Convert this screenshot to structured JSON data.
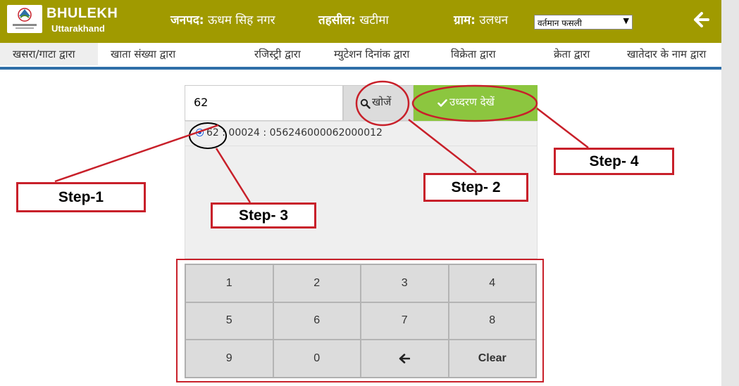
{
  "header": {
    "brand_title": "BHULEKH",
    "brand_subtitle": "Uttarakhand",
    "district_label": "जनपद:",
    "district_value": "ऊधम सिह नगर",
    "tehsil_label": "तहसील:",
    "tehsil_value": "खटीमा",
    "village_label": "ग्राम:",
    "village_value": "उलधन",
    "season_select_value": "वर्तमान फसली",
    "back_icon": "arrow-left-icon"
  },
  "tabs": [
    {
      "label": "खसरा/गाटा द्वारा"
    },
    {
      "label": "खाता संख्या द्वारा"
    },
    {
      "label": "रजिस्ट्री द्वारा"
    },
    {
      "label": "म्युटेशन दिनांक द्वारा"
    },
    {
      "label": "विक्रेता द्वारा"
    },
    {
      "label": "क्रेता द्वारा"
    },
    {
      "label": "खातेदार के नाम द्वारा"
    }
  ],
  "search": {
    "input_value": "62",
    "search_button_label": "खोजें",
    "view_button_label": "उध्दरण देखें"
  },
  "results": [
    {
      "text": "62 : 00024 : 056246000062000012",
      "selected": true
    }
  ],
  "keypad": [
    "1",
    "2",
    "3",
    "4",
    "5",
    "6",
    "7",
    "8",
    "9",
    "0",
    "←",
    "Clear"
  ],
  "annotations": {
    "step1": "Step-1",
    "step2": "Step- 2",
    "step3": "Step- 3",
    "step4": "Step- 4"
  },
  "colors": {
    "header_bg": "#a09a00",
    "accent_green": "#8cc63f",
    "annotation_red": "#c8202a",
    "tab_underline": "#2f6fa8"
  }
}
